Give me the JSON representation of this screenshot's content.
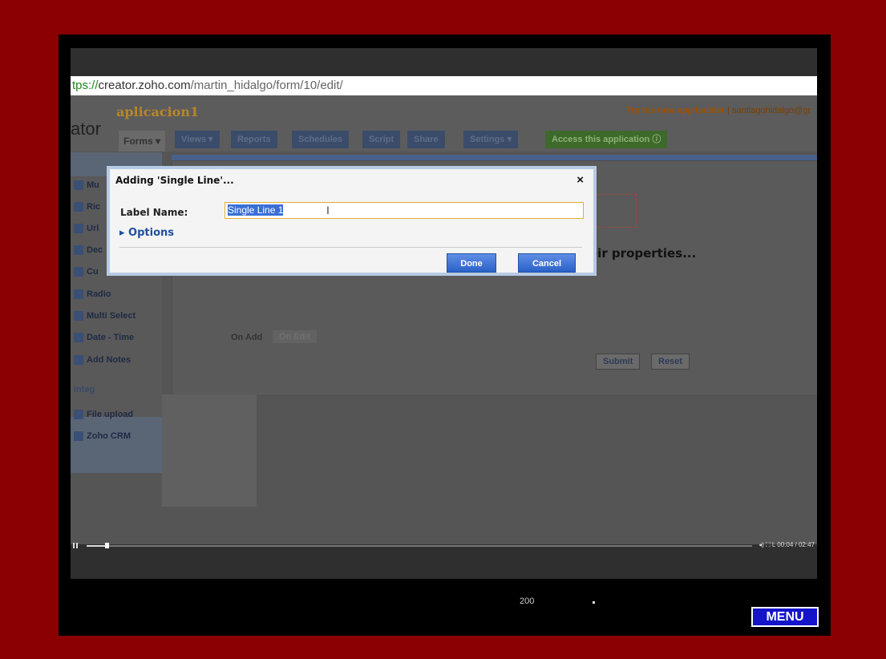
{
  "browser": {
    "url_scheme": "tps://",
    "url_host": "creator.zoho.com",
    "url_path": "/martin_hidalgo/form/10/edit/"
  },
  "app": {
    "name": "aplicacion1",
    "brand_fragment": "ator",
    "try_new": "Try the new app builder",
    "user": "| santiagohidalgo@gr",
    "tabs": [
      "Forms ▾",
      "Views ▾",
      "Reports",
      "Schedules",
      "Script",
      "Share",
      "Settings ▾"
    ],
    "access_tab": "Access this application ⓘ"
  },
  "sidebar": {
    "items": [
      "Mu",
      "Ric",
      "Url",
      "Dec",
      "Cu",
      "Radio",
      "Multi Select",
      "Date - Time",
      "Add Notes",
      "File upload",
      "Zoho CRM"
    ],
    "section_label": "Integ"
  },
  "builder": {
    "on_add": "On Add",
    "on_edit": "On Edit",
    "submit": "Submit",
    "reset": "Reset",
    "properties_text": "eir properties..."
  },
  "dialog": {
    "title": "Adding 'Single Line'...",
    "close": "×",
    "label_name": "Label Name:",
    "label_value": "Single Line 1",
    "options": "▸ Options",
    "done": "Done",
    "cancel": "Cancel"
  },
  "player": {
    "time": "◂) ⛶ L  00:04 / 02:47",
    "marker": "200",
    "menu": "MENU"
  },
  "colors": {
    "border": "#8b0000",
    "menu_button": "#1414c8",
    "dialog_button": "#2b61c8"
  }
}
